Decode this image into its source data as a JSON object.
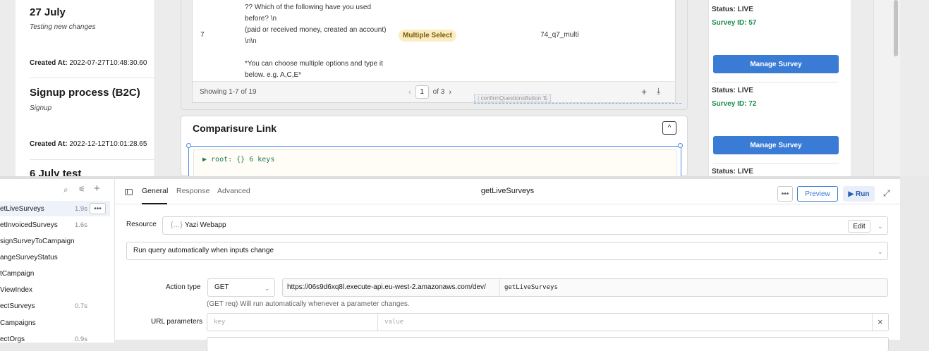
{
  "canvas": {
    "left_cards": [
      {
        "title": "27 July",
        "subtitle": "Testing new changes",
        "created_label": "Created At:",
        "created_value": "2022-07-27T10:48:30.60"
      },
      {
        "title": "Signup process (B2C)",
        "subtitle": "Signup",
        "created_label": "Created At:",
        "created_value": "2022-12-12T10:01:28.65"
      },
      {
        "title": "6 July test"
      }
    ],
    "questions_table": {
      "row_number": "7",
      "question_text": "?? Which of the following have you used before? \\n\n(paid or received money, created an account) \\n\\n\n\n*You can choose multiple options and type it below. e.g. A,C,E*",
      "type_pill": "Multiple Select",
      "key": "74_q7_multi",
      "showing": "Showing 1-7 of 19",
      "page": "1",
      "of_pages": "of 3",
      "component_tag": "confirmQuestionsButton"
    },
    "comparisure": {
      "title": "Comparisure Link",
      "json_preview": "▶ root: {} 6 keys"
    },
    "right_cards": [
      {
        "status": "Status: LIVE",
        "survey_id": "Survey ID: 57",
        "button": "Manage Survey"
      },
      {
        "status": "Status: LIVE",
        "survey_id": "Survey ID: 72",
        "button": "Manage Survey"
      },
      {
        "status": "Status: LIVE"
      }
    ]
  },
  "query_list": [
    {
      "name": "getLiveSurveys",
      "time": "1.9s",
      "selected": true
    },
    {
      "name": "getInvoicedSurveys",
      "time": "1.6s"
    },
    {
      "name": "assignSurveyToCampaign",
      "time": ""
    },
    {
      "name": "changeSurveyStatus",
      "time": ""
    },
    {
      "name": "getCampaign",
      "time": ""
    },
    {
      "name": "getViewIndex",
      "time": ""
    },
    {
      "name": "selectSurveys",
      "time": "0.7s"
    },
    {
      "name": "getCampaigns",
      "time": ""
    },
    {
      "name": "selectOrgs",
      "time": "0.9s"
    }
  ],
  "query_list_visible": [
    "etLiveSurveys",
    "etInvoicedSurveys",
    "signSurveyToCampaign",
    "angeSurveyStatus",
    "tCampaign",
    "ViewIndex",
    "ectSurveys",
    "Campaigns",
    "ectOrgs"
  ],
  "editor": {
    "tabs": [
      "General",
      "Response",
      "Advanced"
    ],
    "query_name": "getLiveSurveys",
    "more": "•••",
    "preview": "Preview",
    "run": "▶ Run",
    "resource_label": "Resource",
    "resource_value": "Yazi Webapp",
    "edit": "Edit",
    "run_mode": "Run query automatically when inputs change",
    "action_type_label": "Action type",
    "action_type_value": "GET",
    "url_base": "https://06s9d6xq8l.execute-api.eu-west-2.amazonaws.com/dev/",
    "url_path": "getLiveSurveys",
    "helper": "(GET req) Will run automatically whenever a parameter changes.",
    "url_params_label": "URL parameters",
    "key_placeholder": "key",
    "value_placeholder": "value"
  }
}
